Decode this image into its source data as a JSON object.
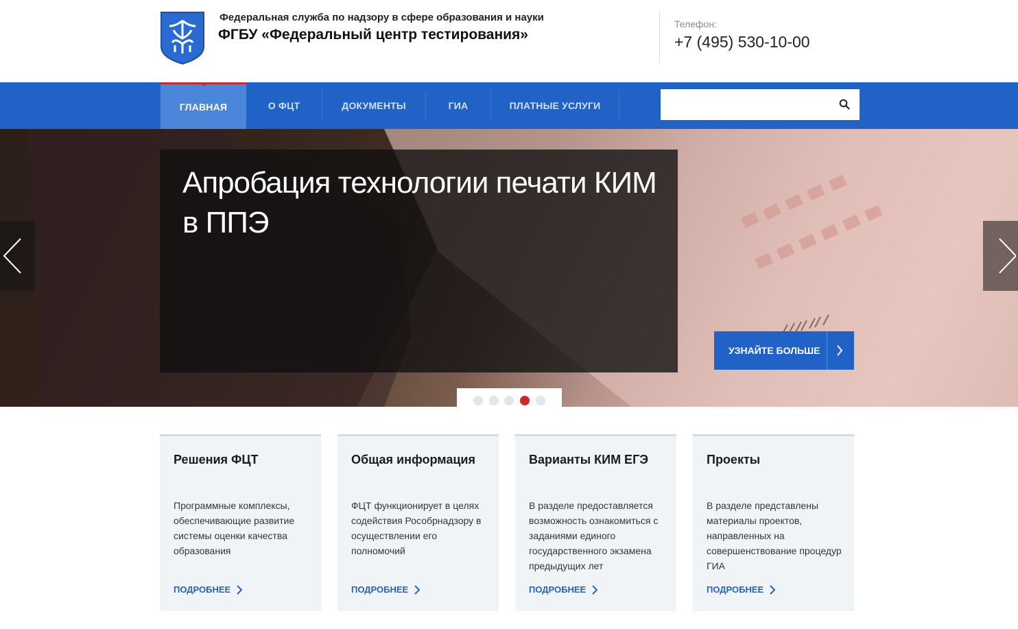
{
  "header": {
    "agency": "Федеральная служба по надзору в сфере образования и науки",
    "org": "ФГБУ «Федеральный центр тестирования»",
    "phone_label": "Телефон:",
    "phone": "+7 (495) 530-10-00"
  },
  "nav": {
    "items": [
      {
        "label": "ГЛАВНАЯ",
        "active": true
      },
      {
        "label": "О ФЦТ"
      },
      {
        "label": "ДОКУМЕНТЫ"
      },
      {
        "label": "ГИА"
      },
      {
        "label": "ПЛАТНЫЕ УСЛУГИ"
      }
    ],
    "search_placeholder": "",
    "search_icon": "search-icon"
  },
  "hero": {
    "title": "Апробация технологии печати КИМ в ППЭ",
    "cta_label": "УЗНАЙТЕ БОЛЬШЕ",
    "slides_total": 5,
    "active_slide": 4
  },
  "cards": [
    {
      "title": "Решения ФЦТ",
      "text": "Программные комплексы, обеспечивающие развитие системы оценки качества образования",
      "link": "ПОДРОБНЕЕ"
    },
    {
      "title": "Общая информация",
      "text": "ФЦТ функционирует в целях содействия Рособрнадзору в осуществлении его полномочий",
      "link": "ПОДРОБНЕЕ"
    },
    {
      "title": "Варианты КИМ ЕГЭ",
      "text": "В разделе предоставляется возможность ознакомиться с заданиями единого государственного экзамена предыдущих лет",
      "link": "ПОДРОБНЕЕ"
    },
    {
      "title": "Проекты",
      "text": "В разделе представлены материалы проектов, направленных на совершенствование процедур ГИА",
      "link": "ПОДРОБНЕЕ"
    }
  ],
  "colors": {
    "primary": "#2162c6",
    "nav_active": "#4a86d9",
    "accent_red": "#cc2a2a",
    "card_bg": "#f1f4f7"
  }
}
